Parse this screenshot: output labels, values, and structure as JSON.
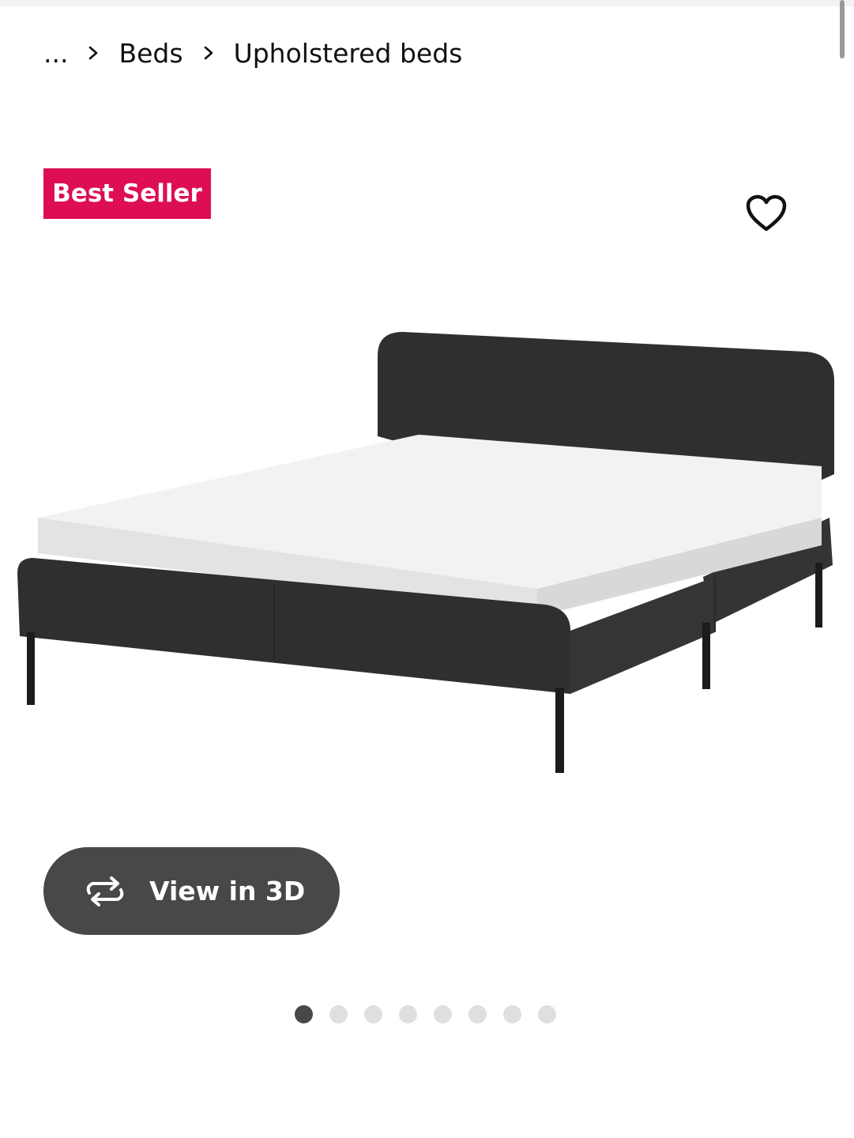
{
  "breadcrumb": {
    "items": [
      "...",
      "Beds",
      "Upholstered beds"
    ]
  },
  "badge": {
    "label": "Best Seller",
    "color": "#dd0e53"
  },
  "favorite": {
    "icon": "heart-outline-icon"
  },
  "product_image": {
    "alt": "Upholstered bed frame with mattress"
  },
  "view3d": {
    "label": "View in 3D",
    "icon": "rotate-3d-icon"
  },
  "carousel": {
    "total": 8,
    "active_index": 0
  },
  "colors": {
    "accent": "#dd0e53",
    "button": "#484848",
    "dot_inactive": "#dfdfdf"
  }
}
